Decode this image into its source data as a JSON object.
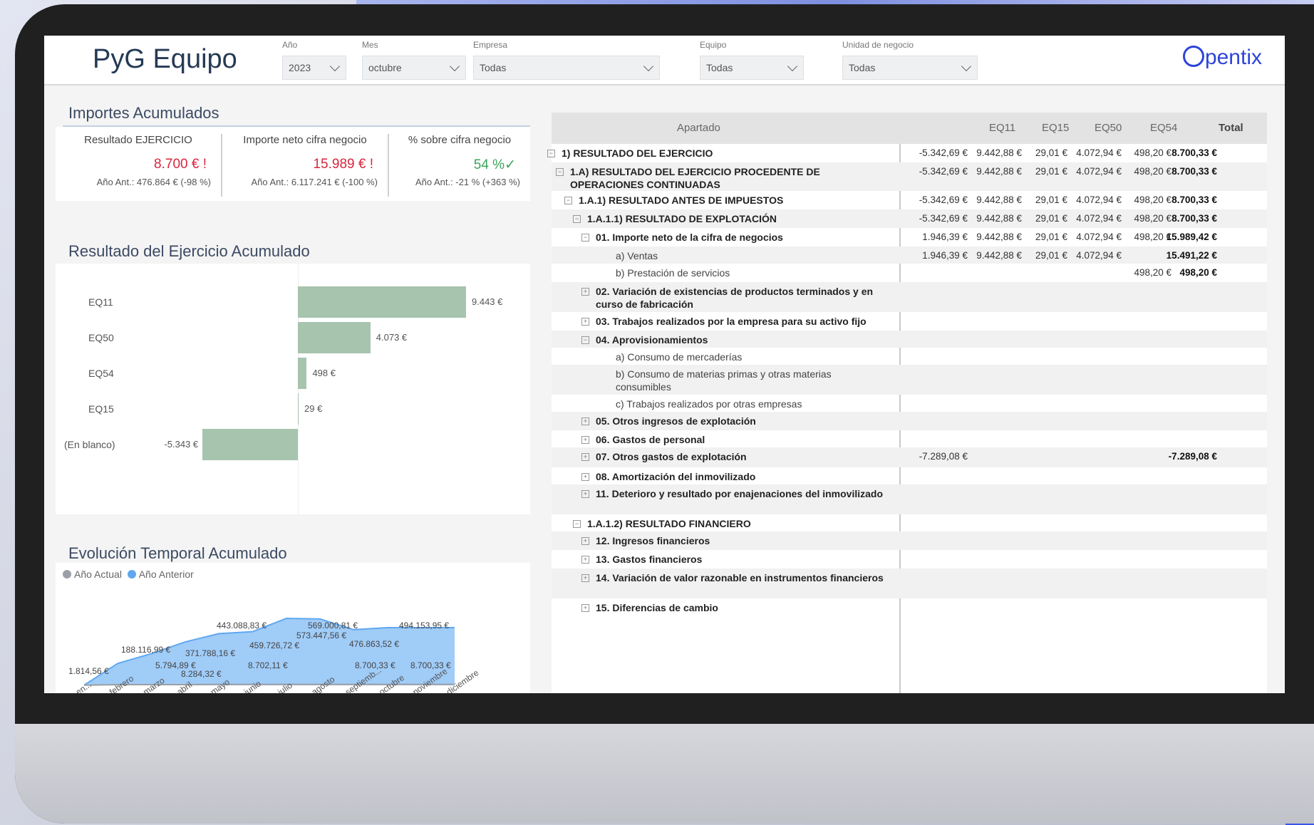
{
  "header": {
    "title": "PyG Equipo",
    "logo": "pentix"
  },
  "filters": [
    {
      "label": "Año",
      "value": "2023"
    },
    {
      "label": "Mes",
      "value": "octubre"
    },
    {
      "label": "Empresa",
      "value": "Todas"
    },
    {
      "label": "Equipo",
      "value": "Todas"
    },
    {
      "label": "Unidad de negocio",
      "value": "Todas"
    }
  ],
  "kpis": {
    "title": "Importes Acumulados",
    "items": [
      {
        "title": "Resultado EJERCICIO",
        "value": "8.700 € !",
        "sub": "Año Ant.: 476.864 € (-98 %)"
      },
      {
        "title": "Importe neto cifra negocio",
        "value": "15.989 € !",
        "sub": "Año Ant.: 6.117.241 € (-100 %)"
      },
      {
        "title": "% sobre cifra negocio",
        "value": "54 %✓",
        "sub": "Año Ant.: -21 % (+363 %)"
      }
    ]
  },
  "bar_section": {
    "title": "Resultado del Ejercicio Acumulado",
    "chart_data": {
      "type": "bar",
      "categories": [
        "EQ11",
        "EQ50",
        "EQ54",
        "EQ15",
        "(En blanco)"
      ],
      "values": [
        9443,
        4073,
        498,
        29,
        -5343
      ],
      "labels": [
        "9.443 €",
        "4.073 €",
        "498 €",
        "29 €",
        "-5.343 €"
      ]
    }
  },
  "line_section": {
    "title": "Evolución Temporal Acumulado",
    "legend": [
      "Año Actual",
      "Año Anterior"
    ],
    "colors": {
      "actual": "#9aa0a6",
      "anterior": "#5fa8f0"
    },
    "chart_data": {
      "type": "area",
      "x": [
        "en...",
        "febrero",
        "marzo",
        "abril",
        "mayo",
        "junio",
        "julio",
        "agosto",
        "septiemb...",
        "octubre",
        "noviembre",
        "diciembre"
      ],
      "series": [
        {
          "name": "Año Anterior",
          "values": [
            1814.56,
            188116.99,
            271788.16,
            371788.16,
            443088.83,
            459726.72,
            573447.56,
            569000.81,
            476863.52,
            494153.95,
            494153.95,
            494153.95
          ]
        },
        {
          "name": "Año Actual",
          "values": [
            1814.56,
            5794.89,
            5794.89,
            5794.89,
            8702.11,
            8702.11,
            8284.32,
            8284.32,
            8700.33,
            8700.33,
            8700.33,
            8700.33
          ]
        }
      ],
      "point_labels": [
        "1.814,56 €",
        "188.116,99 €",
        "371.788,16 €",
        "443.088,83 €",
        "459.726,72 €",
        "573.447,56 €",
        "569.000,81 €",
        "476.863,52 €",
        "494.153,95 €",
        "5.794,89 €",
        "8.702,11 €",
        "8.284,32 €",
        "8.700,33 €",
        "8.700,33 €"
      ]
    }
  },
  "matrix": {
    "columns": [
      "Apartado",
      "EQ11",
      "EQ15",
      "EQ50",
      "EQ54",
      "Total"
    ],
    "rows": [
      {
        "label": "1) RESULTADO DEL EJERCICIO",
        "vals": [
          "-5.342,69 €",
          "9.442,88 €",
          "29,01 €",
          "4.072,94 €",
          "498,20 €",
          "8.700,33 €"
        ]
      },
      {
        "label": "1.A) RESULTADO DEL EJERCICIO PROCEDENTE DE OPERACIONES CONTINUADAS",
        "vals": [
          "-5.342,69 €",
          "9.442,88 €",
          "29,01 €",
          "4.072,94 €",
          "498,20 €",
          "8.700,33 €"
        ]
      },
      {
        "label": "1.A.1) RESULTADO ANTES DE IMPUESTOS",
        "vals": [
          "-5.342,69 €",
          "9.442,88 €",
          "29,01 €",
          "4.072,94 €",
          "498,20 €",
          "8.700,33 €"
        ]
      },
      {
        "label": "1.A.1.1) RESULTADO DE EXPLOTACIÓN",
        "vals": [
          "-5.342,69 €",
          "9.442,88 €",
          "29,01 €",
          "4.072,94 €",
          "498,20 €",
          "8.700,33 €"
        ]
      },
      {
        "label": "01. Importe neto de la cifra de negocios",
        "vals": [
          "1.946,39 €",
          "9.442,88 €",
          "29,01 €",
          "4.072,94 €",
          "498,20 €",
          "15.989,42 €"
        ]
      },
      {
        "label": "a) Ventas",
        "vals": [
          "1.946,39 €",
          "9.442,88 €",
          "29,01 €",
          "4.072,94 €",
          "",
          "15.491,22 €"
        ]
      },
      {
        "label": "b) Prestación de servicios",
        "vals": [
          "",
          "",
          "",
          "",
          "498,20 €",
          "498,20 €"
        ]
      },
      {
        "label": "02. Variación de existencias de productos terminados y en curso de fabricación",
        "vals": [
          "",
          "",
          "",
          "",
          "",
          ""
        ]
      },
      {
        "label": "03. Trabajos realizados por la empresa para su activo fijo",
        "vals": [
          "",
          "",
          "",
          "",
          "",
          ""
        ]
      },
      {
        "label": "04. Aprovisionamientos",
        "vals": [
          "",
          "",
          "",
          "",
          "",
          ""
        ]
      },
      {
        "label": "a) Consumo de mercaderías",
        "vals": [
          "",
          "",
          "",
          "",
          "",
          ""
        ]
      },
      {
        "label": "b) Consumo de materias primas y otras materias consumibles",
        "vals": [
          "",
          "",
          "",
          "",
          "",
          ""
        ]
      },
      {
        "label": "c) Trabajos realizados por otras empresas",
        "vals": [
          "",
          "",
          "",
          "",
          "",
          ""
        ]
      },
      {
        "label": "05. Otros ingresos de explotación",
        "vals": [
          "",
          "",
          "",
          "",
          "",
          ""
        ]
      },
      {
        "label": "06. Gastos de personal",
        "vals": [
          "",
          "",
          "",
          "",
          "",
          ""
        ]
      },
      {
        "label": "07. Otros gastos de explotación",
        "vals": [
          "-7.289,08 €",
          "",
          "",
          "",
          "",
          "-7.289,08 €"
        ]
      },
      {
        "label": "08. Amortización del inmovilizado",
        "vals": [
          "",
          "",
          "",
          "",
          "",
          ""
        ]
      },
      {
        "label": "11. Deterioro y resultado por enajenaciones del inmovilizado",
        "vals": [
          "",
          "",
          "",
          "",
          "",
          ""
        ]
      },
      {
        "label": "1.A.1.2) RESULTADO FINANCIERO",
        "vals": [
          "",
          "",
          "",
          "",
          "",
          ""
        ]
      },
      {
        "label": "12. Ingresos financieros",
        "vals": [
          "",
          "",
          "",
          "",
          "",
          ""
        ]
      },
      {
        "label": "13. Gastos financieros",
        "vals": [
          "",
          "",
          "",
          "",
          "",
          ""
        ]
      },
      {
        "label": "14. Variación de valor razonable en instrumentos financieros",
        "vals": [
          "",
          "",
          "",
          "",
          "",
          ""
        ]
      },
      {
        "label": "15. Diferencias de cambio",
        "vals": [
          "",
          "",
          "",
          "",
          "",
          ""
        ]
      }
    ]
  }
}
